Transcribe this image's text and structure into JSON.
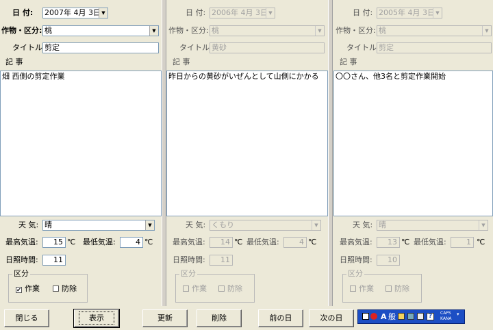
{
  "labels": {
    "date": "日 付:",
    "crop": "作物・区分:",
    "title": "タイトル:",
    "article": "記 事",
    "weather": "天 気:",
    "max_temp": "最高気温:",
    "min_temp": "最低気温:",
    "unit_c": "℃",
    "sunshine": "日照時間:",
    "category": "区分",
    "work": "作業",
    "pest": "防除"
  },
  "panels": [
    {
      "enabled": true,
      "date": "2007年 4月 3日",
      "crop": "桃",
      "title": "剪定",
      "article": "畑 西側の剪定作業",
      "weather": "晴",
      "max_temp": "15",
      "min_temp": "4",
      "sunshine": "11",
      "work_checked": true,
      "pest_checked": false
    },
    {
      "enabled": false,
      "date": "2006年 4月 3日",
      "crop": "桃",
      "title": "黄砂",
      "article": "昨日からの黄砂がいぜんとして山側にかかる",
      "weather": "くもり",
      "max_temp": "14",
      "min_temp": "4",
      "sunshine": "11",
      "work_checked": false,
      "pest_checked": false
    },
    {
      "enabled": false,
      "date": "2005年 4月 3日",
      "crop": "桃",
      "title": "剪定",
      "article": "〇〇さん、他3名と剪定作業開始",
      "weather": "晴",
      "max_temp": "13",
      "min_temp": "1",
      "sunshine": "10",
      "work_checked": false,
      "pest_checked": false
    }
  ],
  "buttons": {
    "close": "閉じる",
    "show": "表示",
    "update": "更新",
    "delete": "削除",
    "prev_day": "前の日",
    "next_day": "次の日"
  },
  "ime": {
    "mode": "A",
    "dictionary": "般",
    "caps": "CAPS",
    "kana": "KANA"
  },
  "colors": {
    "background": "#ece9d8",
    "ime_bar": "#1c4ec4"
  }
}
